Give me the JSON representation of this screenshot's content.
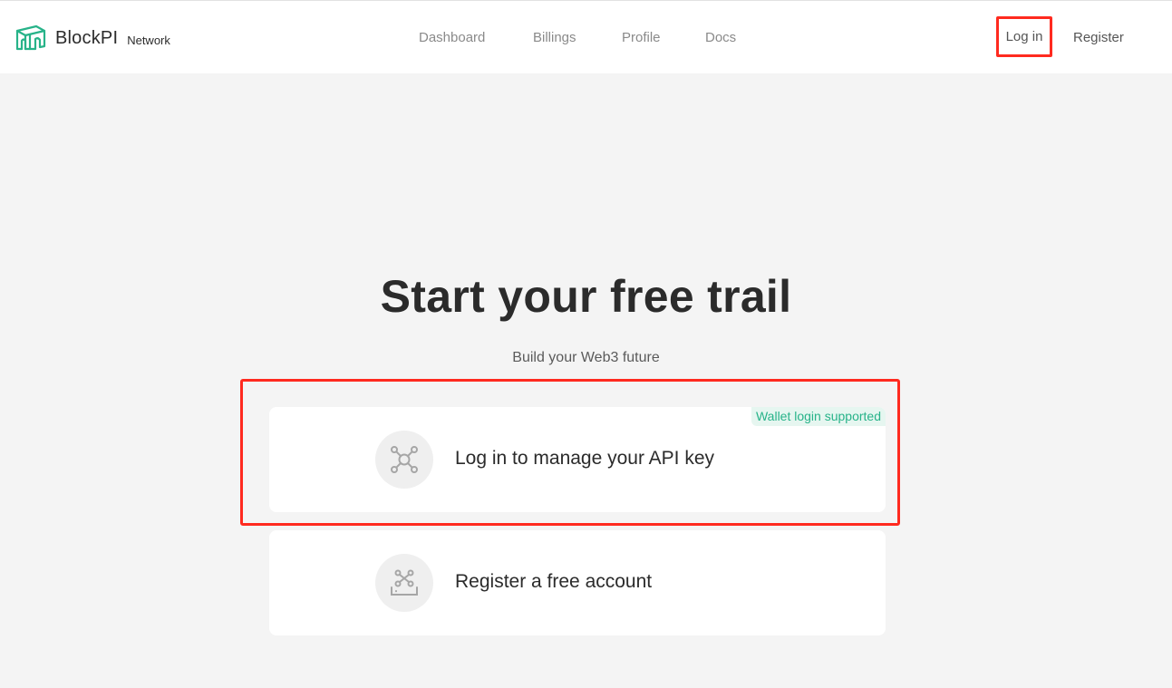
{
  "brand": {
    "name": "BlockPI",
    "subname": "Network",
    "accent_color": "#27b389",
    "logo_icon": "blockpi-bridge-logo-icon"
  },
  "nav": {
    "items": [
      {
        "label": "Dashboard"
      },
      {
        "label": "Billings"
      },
      {
        "label": "Profile"
      },
      {
        "label": "Docs"
      }
    ]
  },
  "auth": {
    "login_label": "Log in",
    "register_label": "Register"
  },
  "hero": {
    "title": "Start your free trail",
    "subtitle": "Build your Web3 future"
  },
  "cards": [
    {
      "label": "Log in to manage your API key",
      "badge": "Wallet login supported",
      "icon": "network-nodes-icon"
    },
    {
      "label": "Register a free account",
      "icon": "register-inbox-icon"
    }
  ],
  "highlight_color": "#ff2a1f"
}
